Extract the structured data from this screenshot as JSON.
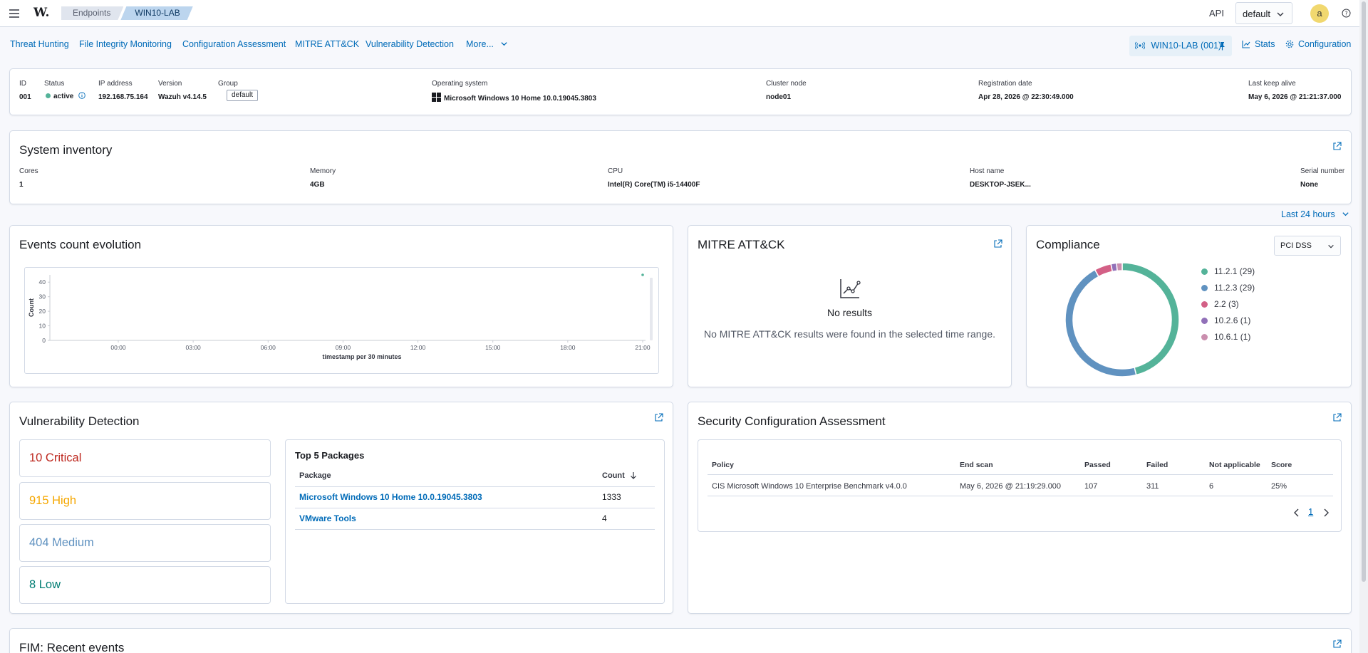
{
  "topbar": {
    "logo": "W.",
    "breadcrumbs": [
      "Endpoints",
      "WIN10-LAB"
    ],
    "api_label": "API",
    "api_select": "default",
    "avatar_letter": "a"
  },
  "nav": {
    "tabs": [
      "Threat Hunting",
      "File Integrity Monitoring",
      "Configuration Assessment",
      "MITRE ATT&CK",
      "Vulnerability Detection",
      "More..."
    ],
    "agent_button": "WIN10-LAB (001)",
    "stats": "Stats",
    "configuration": "Configuration"
  },
  "agent": {
    "id_label": "ID",
    "id": "001",
    "status_label": "Status",
    "status": "active",
    "ip_label": "IP address",
    "ip": "192.168.75.164",
    "version_label": "Version",
    "version": "Wazuh v4.14.5",
    "group_label": "Group",
    "group": "default",
    "os_label": "Operating system",
    "os": "Microsoft Windows 10 Home 10.0.19045.3803",
    "cluster_label": "Cluster node",
    "cluster": "node01",
    "reg_label": "Registration date",
    "reg": "Apr 28, 2026 @ 22:30:49.000",
    "keepalive_label": "Last keep alive",
    "keepalive": "May 6, 2026 @ 21:21:37.000"
  },
  "inventory": {
    "title": "System inventory",
    "cores_label": "Cores",
    "cores": "1",
    "memory_label": "Memory",
    "memory": "4GB",
    "cpu_label": "CPU",
    "cpu": "Intel(R) Core(TM) i5-14400F",
    "host_label": "Host name",
    "host": "DESKTOP-JSEK...",
    "serial_label": "Serial number",
    "serial": "None"
  },
  "time_range": "Last 24 hours",
  "events": {
    "title": "Events count evolution",
    "chart_data": {
      "type": "scatter",
      "ylabel": "Count",
      "xlabel": "timestamp per 30 minutes",
      "ylim": [
        0,
        45
      ],
      "yticks": [
        "0",
        "10",
        "20",
        "30",
        "40"
      ],
      "xticks": [
        "00:00",
        "03:00",
        "06:00",
        "09:00",
        "12:00",
        "15:00",
        "18:00",
        "21:00"
      ],
      "points": [
        {
          "x": "21:00",
          "y": 45
        }
      ]
    }
  },
  "mitre": {
    "title": "MITRE ATT&CK",
    "empty_title": "No results",
    "empty_text": "No MITRE ATT&CK results were found in the selected time range."
  },
  "compliance": {
    "title": "Compliance",
    "select": "PCI DSS",
    "chart_data": {
      "type": "pie",
      "slices": [
        {
          "name": "11.2.1",
          "label": "11.2.1 (29)",
          "value": 29,
          "color": "#54b399"
        },
        {
          "name": "11.2.3",
          "label": "11.2.3 (29)",
          "value": 29,
          "color": "#6092c0"
        },
        {
          "name": "2.2",
          "label": "2.2 (3)",
          "value": 3,
          "color": "#d36086"
        },
        {
          "name": "10.2.6",
          "label": "10.2.6 (1)",
          "value": 1,
          "color": "#9170b8"
        },
        {
          "name": "10.6.1",
          "label": "10.6.1 (1)",
          "value": 1,
          "color": "#ca8eae"
        }
      ]
    }
  },
  "vuln": {
    "title": "Vulnerability Detection",
    "critical": "10 Critical",
    "high": "915 High",
    "medium": "404 Medium",
    "low": "8 Low",
    "colors": {
      "critical": "#bd271e",
      "high": "#f5a700",
      "medium": "#6092c0",
      "low": "#017d73"
    },
    "top_title": "Top 5 Packages",
    "col_package": "Package",
    "col_count": "Count",
    "rows": [
      {
        "package": "Microsoft Windows 10 Home 10.0.19045.3803",
        "count": "1333"
      },
      {
        "package": "VMware Tools",
        "count": "4"
      }
    ]
  },
  "sca": {
    "title": "Security Configuration Assessment",
    "headers": [
      "Policy",
      "End scan",
      "Passed",
      "Failed",
      "Not applicable",
      "Score"
    ],
    "row": {
      "policy": "CIS Microsoft Windows 10 Enterprise Benchmark v4.0.0",
      "end_scan": "May 6, 2026 @ 21:19:29.000",
      "passed": "107",
      "failed": "311",
      "na": "6",
      "score": "25%"
    },
    "page": "1"
  },
  "fim": {
    "title": "FIM: Recent events"
  }
}
